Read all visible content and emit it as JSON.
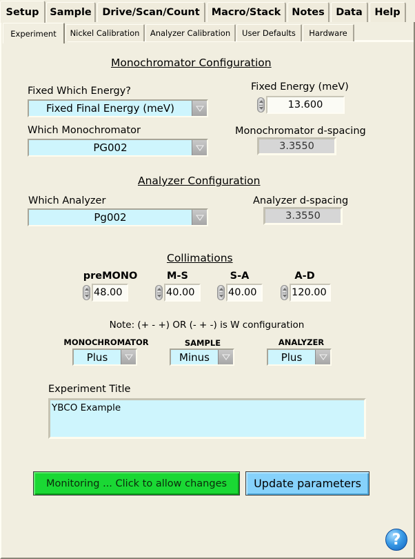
{
  "top_tabs": [
    {
      "label": "Setup",
      "active": true
    },
    {
      "label": "Sample",
      "active": false
    },
    {
      "label": "Drive/Scan/Count",
      "active": false
    },
    {
      "label": "Macro/Stack",
      "active": false
    },
    {
      "label": "Notes",
      "active": false
    },
    {
      "label": "Data",
      "active": false
    },
    {
      "label": "Help",
      "active": false
    }
  ],
  "sub_tabs": [
    {
      "label": "Experiment",
      "active": true
    },
    {
      "label": "Nickel Calibration",
      "active": false
    },
    {
      "label": "Analyzer Calibration",
      "active": false
    },
    {
      "label": "User Defaults",
      "active": false
    },
    {
      "label": "Hardware",
      "active": false
    }
  ],
  "monochromator_section": {
    "title": "Monochromator Configuration",
    "fixed_which_energy": {
      "label": "Fixed Which Energy?",
      "value": "Fixed Final Energy (meV)"
    },
    "fixed_energy": {
      "label": "Fixed Energy (meV)",
      "value": "13.600"
    },
    "which_monochromator": {
      "label": "Which Monochromator",
      "value": "PG002"
    },
    "mono_d_spacing": {
      "label": "Monochromator d-spacing",
      "value": "3.3550"
    }
  },
  "analyzer_section": {
    "title": "Analyzer Configuration",
    "which_analyzer": {
      "label": "Which Analyzer",
      "value": "Pg002"
    },
    "analyzer_d_spacing": {
      "label": "Analyzer d-spacing",
      "value": "3.3550"
    }
  },
  "collimations": {
    "title": "Collimations",
    "items": [
      {
        "label": "preMONO",
        "value": "48.00"
      },
      {
        "label": "M-S",
        "value": "40.00"
      },
      {
        "label": "S-A",
        "value": "40.00"
      },
      {
        "label": "A-D",
        "value": "120.00"
      }
    ]
  },
  "scattering": {
    "note": "Note: (+ - +) OR (- + -) is W configuration",
    "monochromator": {
      "label": "MONOCHROMATOR",
      "value": "Plus"
    },
    "sample": {
      "label": "SAMPLE",
      "value": "Minus"
    },
    "analyzer": {
      "label": "ANALYZER",
      "value": "Plus"
    }
  },
  "experiment_title": {
    "label": "Experiment Title",
    "value": "YBCO Example"
  },
  "buttons": {
    "monitoring": "Monitoring ... Click to allow changes",
    "update": "Update parameters"
  },
  "help_icon_glyph": "?",
  "colors": {
    "background": "#f1eee0",
    "control_fill": "#cef5fd",
    "monitoring_button": "#1ad834",
    "update_button": "#86d2fb",
    "indicator_fill": "#d6d6d6"
  }
}
